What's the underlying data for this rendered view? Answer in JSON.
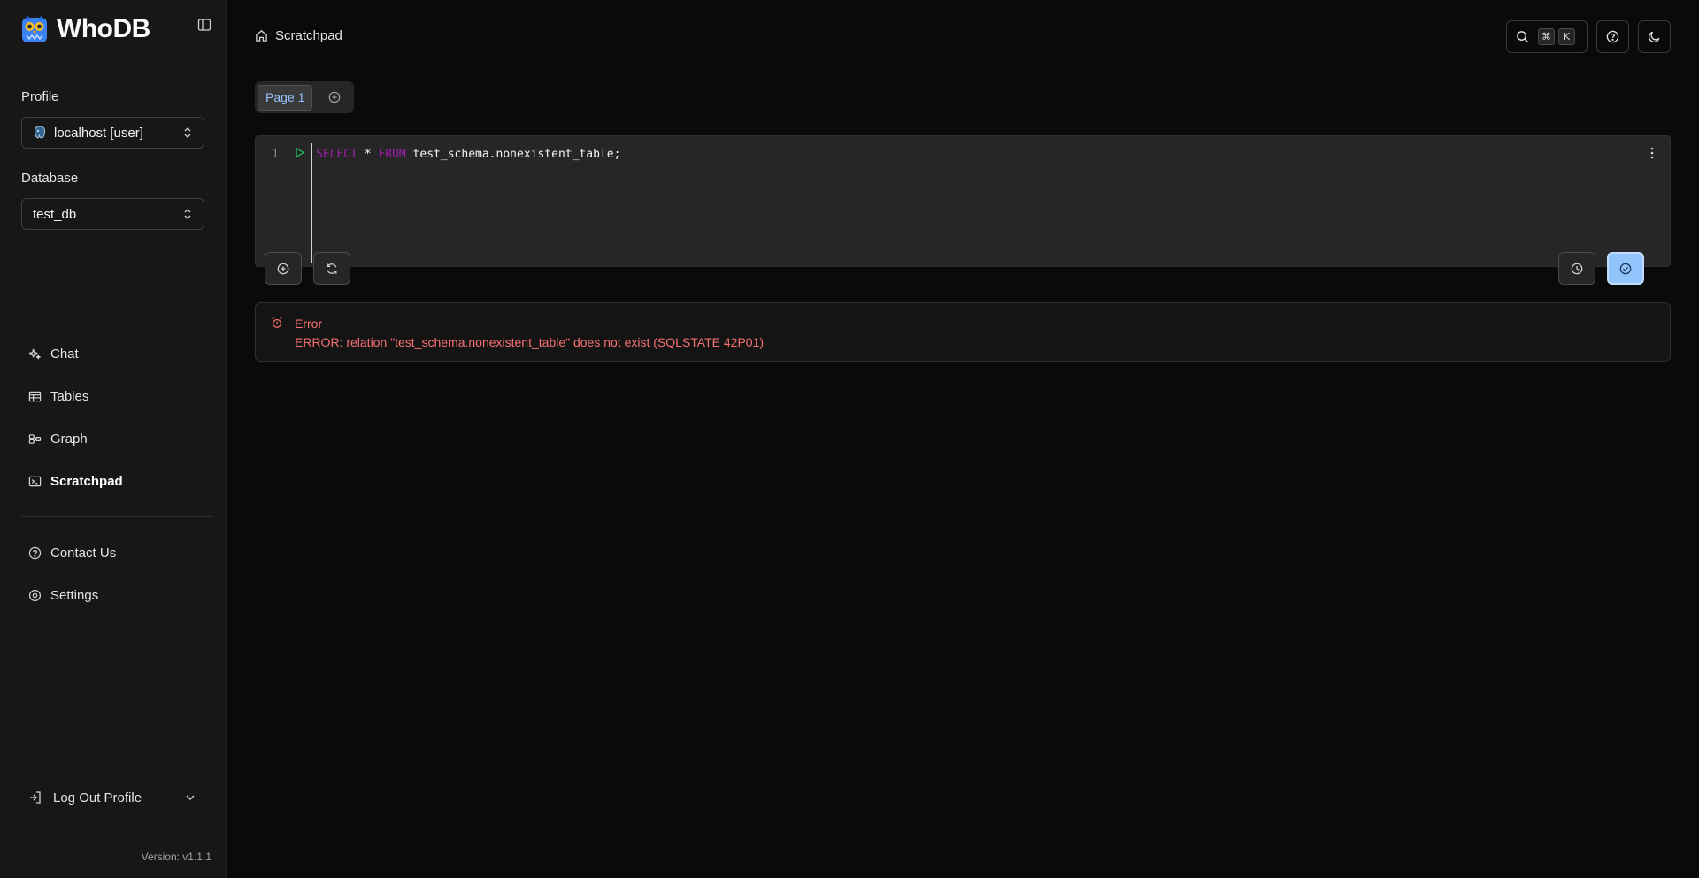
{
  "sidebar": {
    "brand": "WhoDB",
    "profile_label": "Profile",
    "profile_value": "localhost [user]",
    "database_label": "Database",
    "database_value": "test_db",
    "nav": [
      {
        "label": "Chat",
        "icon": "sparkles-icon"
      },
      {
        "label": "Tables",
        "icon": "table-icon"
      },
      {
        "label": "Graph",
        "icon": "graph-icon"
      },
      {
        "label": "Scratchpad",
        "icon": "terminal-icon",
        "active": true
      }
    ],
    "nav_bottom": [
      {
        "label": "Contact Us",
        "icon": "help-circle-icon"
      },
      {
        "label": "Settings",
        "icon": "settings-icon"
      }
    ],
    "logout_label": "Log Out Profile",
    "version": "Version: v1.1.1"
  },
  "header": {
    "breadcrumb": "Scratchpad",
    "kbd_mod": "⌘",
    "kbd_key": "K"
  },
  "pages": {
    "tabs": [
      "Page 1"
    ]
  },
  "editor": {
    "line_number": "1",
    "keyword_select": "SELECT",
    "star": "*",
    "keyword_from": "FROM",
    "table_ref": "test_schema.nonexistent_table;"
  },
  "result": {
    "title": "Error",
    "message": "ERROR: relation \"test_schema.nonexistent_table\" does not exist (SQLSTATE 42P01)"
  },
  "colors": {
    "accent": "#93c5fd",
    "error": "#f87171",
    "keyword": "#a21caf",
    "run": "#22c55e"
  }
}
